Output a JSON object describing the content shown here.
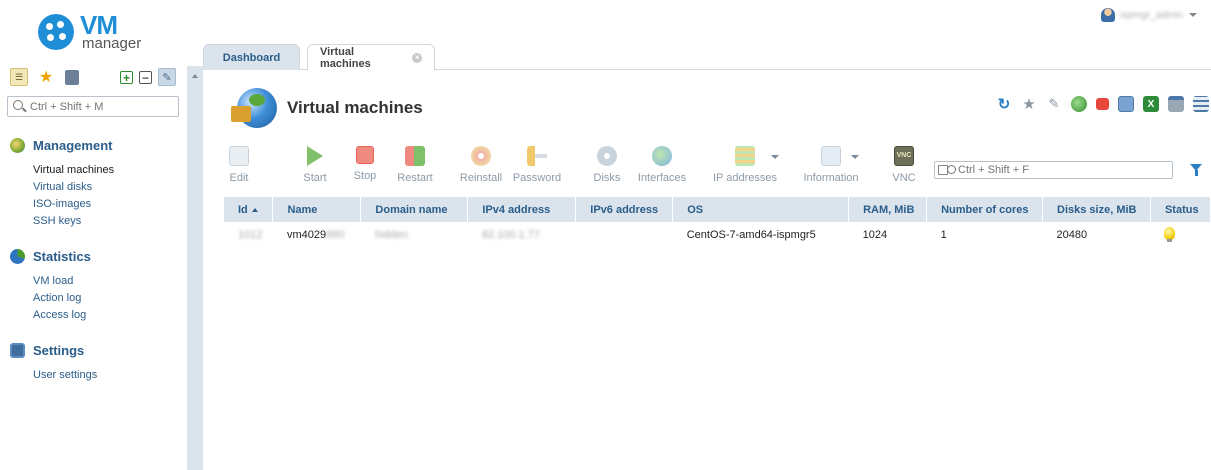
{
  "app": {
    "logo_top": "VM",
    "logo_bottom": "manager",
    "user_name": "ispmgr_admin"
  },
  "sidebar": {
    "search_placeholder": "Ctrl + Shift + M",
    "sections": [
      {
        "title": "Management",
        "items": [
          "Virtual machines",
          "Virtual disks",
          "ISO-images",
          "SSH keys"
        ]
      },
      {
        "title": "Statistics",
        "items": [
          "VM load",
          "Action log",
          "Access log"
        ]
      },
      {
        "title": "Settings",
        "items": [
          "User settings"
        ]
      }
    ]
  },
  "tabs": [
    {
      "label": "Dashboard"
    },
    {
      "label": "Virtual machines"
    }
  ],
  "page": {
    "title": "Virtual machines",
    "search_placeholder": "Ctrl + Shift + F"
  },
  "toolbar": {
    "items": [
      "Edit",
      "Start",
      "Stop",
      "Restart",
      "Reinstall",
      "Password",
      "Disks",
      "Interfaces",
      "IP addresses",
      "Information",
      "VNC"
    ]
  },
  "table": {
    "columns": [
      "Id",
      "Name",
      "Domain name",
      "IPv4 address",
      "IPv6 address",
      "OS",
      "RAM, MiB",
      "Number of cores",
      "Disks size, MiB",
      "Status"
    ],
    "rows": [
      {
        "id": "1012",
        "name": "vm4029",
        "name_hidden": "880",
        "domain": "hidden",
        "ipv4": "82.100.1.77",
        "ipv6": "",
        "os": "CentOS-7-amd64-ispmgr5",
        "ram": "1024",
        "cores": "1",
        "disk": "20480"
      }
    ]
  },
  "colors": {
    "accent": "#2a5d8a",
    "header_bg": "#dbe4ec",
    "logo_blue": "#1e8fd6"
  }
}
